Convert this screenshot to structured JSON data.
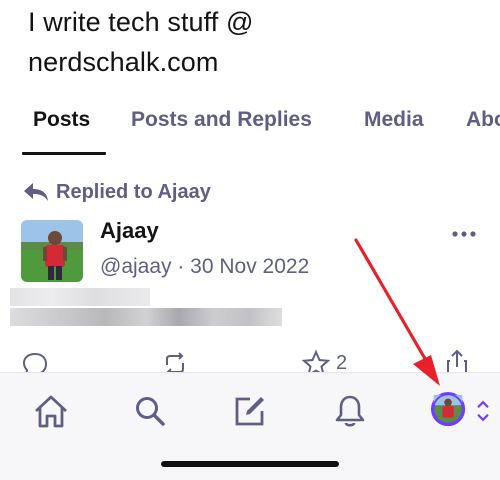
{
  "profile": {
    "bio_line1": "I write tech stuff @",
    "bio_line2": "nerdschalk.com"
  },
  "tabs": [
    {
      "label": "Posts",
      "active": true
    },
    {
      "label": "Posts and Replies",
      "active": false
    },
    {
      "label": "Media",
      "active": false
    },
    {
      "label": "Abo",
      "active": false
    }
  ],
  "post": {
    "reply_context": "Replied to Ajaay",
    "author_name": "Ajaay",
    "author_handle_date": "@ajaay · 30 Nov 2022",
    "like_count": "2"
  },
  "nav": {
    "items": [
      "home-icon",
      "search-icon",
      "compose-icon",
      "notifications-icon",
      "profile-avatar"
    ]
  },
  "colors": {
    "accent": "#5f5f86",
    "annotation": "#e8202a",
    "switcher": "#6f3dff"
  }
}
